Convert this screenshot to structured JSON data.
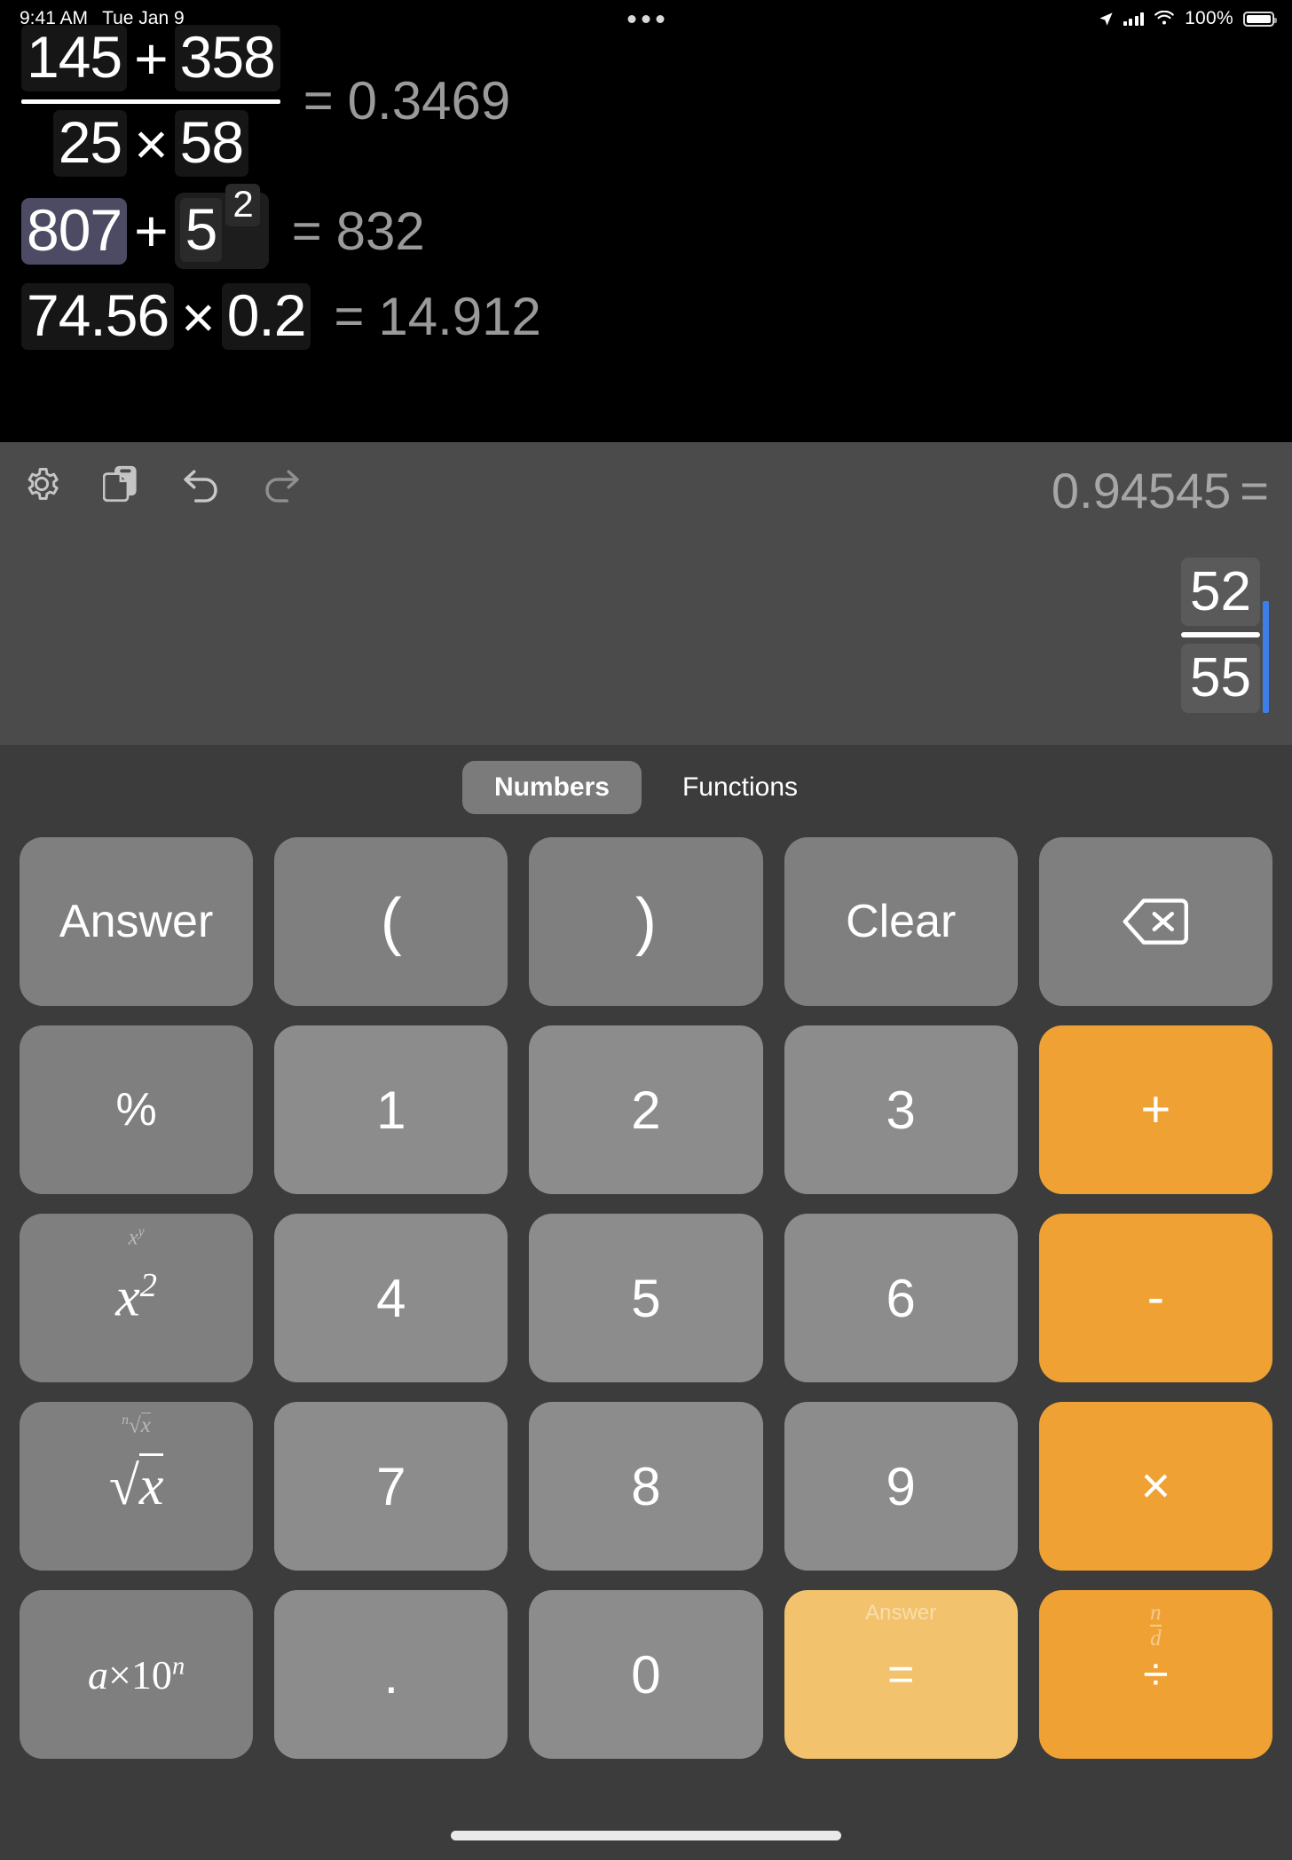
{
  "status_bar": {
    "time": "9:41 AM",
    "date": "Tue Jan 9",
    "battery_percent": "100%",
    "icons": [
      "location-arrow-icon",
      "cellular-signal-icon",
      "wifi-icon",
      "battery-icon"
    ]
  },
  "history": [
    {
      "type": "fraction",
      "numerator": [
        "145",
        "+",
        "358"
      ],
      "denominator": [
        "25",
        "×",
        "58"
      ],
      "equals": "=",
      "result": "0.3469"
    },
    {
      "type": "power",
      "selected_token": "807",
      "operator": "+",
      "base": "5",
      "exponent": "2",
      "equals": "=",
      "result": "832"
    },
    {
      "type": "product",
      "left": "74.56",
      "operator": "×",
      "right": "0.2",
      "equals": "=",
      "result": "14.912"
    }
  ],
  "display": {
    "toolbar": [
      {
        "name": "settings",
        "icon": "gear-icon"
      },
      {
        "name": "copy",
        "icon": "clipboard-copy-icon"
      },
      {
        "name": "undo",
        "icon": "undo-arrow-icon"
      },
      {
        "name": "redo",
        "icon": "redo-arrow-icon"
      }
    ],
    "preview_result": "0.94545",
    "preview_equals": "=",
    "current_numerator": "52",
    "current_denominator": "55"
  },
  "keypad": {
    "tabs": [
      {
        "label": "Numbers",
        "active": true
      },
      {
        "label": "Functions",
        "active": false
      }
    ],
    "rows": [
      [
        {
          "label": "Answer",
          "style": "fn"
        },
        {
          "label": "(",
          "style": "paren"
        },
        {
          "label": ")",
          "style": "paren"
        },
        {
          "label": "Clear",
          "style": "fn"
        },
        {
          "label": "",
          "style": "fn",
          "icon": "backspace-delete-icon"
        }
      ],
      [
        {
          "label": "%",
          "style": "fn"
        },
        {
          "label": "1",
          "style": "num"
        },
        {
          "label": "2",
          "style": "num"
        },
        {
          "label": "3",
          "style": "num"
        },
        {
          "label": "+",
          "style": "op"
        }
      ],
      [
        {
          "label": "x²",
          "style": "fn",
          "sublabel": "xʸ",
          "math": true
        },
        {
          "label": "4",
          "style": "num"
        },
        {
          "label": "5",
          "style": "num"
        },
        {
          "label": "6",
          "style": "num"
        },
        {
          "label": "-",
          "style": "op"
        }
      ],
      [
        {
          "label": "√x",
          "style": "fn",
          "sublabel": "ⁿ√x",
          "math": true
        },
        {
          "label": "7",
          "style": "num"
        },
        {
          "label": "8",
          "style": "num"
        },
        {
          "label": "9",
          "style": "num"
        },
        {
          "label": "×",
          "style": "op"
        }
      ],
      [
        {
          "label": "a×10ⁿ",
          "style": "fn",
          "math": true
        },
        {
          "label": ".",
          "style": "num"
        },
        {
          "label": "0",
          "style": "num"
        },
        {
          "label": "=",
          "style": "equals",
          "sublabel": "Answer"
        },
        {
          "label": "÷",
          "style": "divide",
          "sublabel": "n/d"
        }
      ]
    ],
    "key_labels": {
      "answer": "Answer",
      "open_paren": "(",
      "close_paren": ")",
      "clear": "Clear",
      "percent": "%",
      "one": "1",
      "two": "2",
      "three": "3",
      "four": "4",
      "five": "5",
      "six": "6",
      "seven": "7",
      "eight": "8",
      "nine": "9",
      "zero": "0",
      "decimal": ".",
      "plus": "+",
      "minus": "-",
      "multiply": "×",
      "divide": "÷",
      "equals": "=",
      "square_base": "x",
      "square_exp": "2",
      "power_sub_base": "x",
      "power_sub_exp": "y",
      "sqrt": "x",
      "nthroot_index": "n",
      "nthroot_radicand": "x",
      "sci_a": "a",
      "sci_times": "×10",
      "sci_exp": "n",
      "equals_sub": "Answer",
      "divide_sub_n": "n",
      "divide_sub_d": "d"
    }
  },
  "colors": {
    "background": "#000000",
    "display_panel": "#4b4b4b",
    "keypad_panel": "#3c3c3c",
    "number_key": "#8c8c8c",
    "function_key": "#7f7f7f",
    "operator_orange": "#efa134",
    "equals_orange": "#f3c26c",
    "selection_purple": "#4d4b63",
    "cursor_blue": "#3d7ee8",
    "result_gray": "#9a9a9a"
  }
}
